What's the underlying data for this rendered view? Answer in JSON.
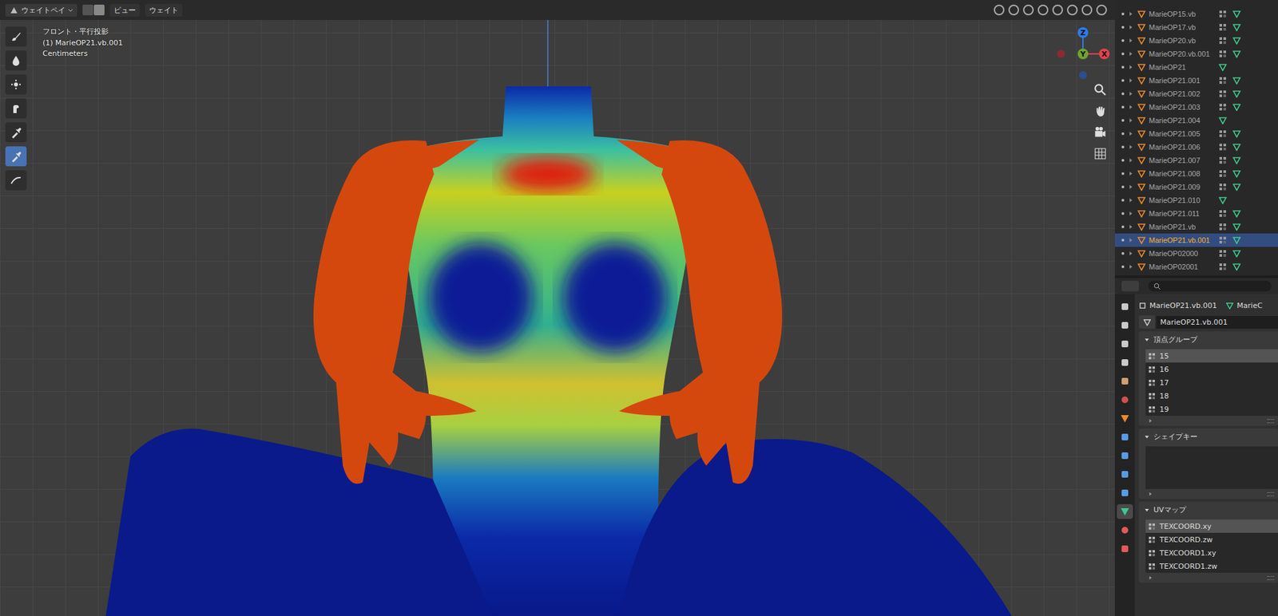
{
  "header": {
    "mode": "ウェイトペイ",
    "menus": [
      "ビュー",
      "ウェイト"
    ]
  },
  "tools": [
    {
      "kind": "brush",
      "selected": false
    },
    {
      "kind": "drop",
      "selected": false
    },
    {
      "kind": "average",
      "selected": false
    },
    {
      "kind": "smear",
      "selected": false
    },
    {
      "kind": "pipette",
      "selected": false
    },
    {
      "kind": "pipette",
      "selected": true
    },
    {
      "kind": "gradient",
      "selected": false
    }
  ],
  "viewport": {
    "overlay": [
      "フロント・平行投影",
      "(1) MarieOP21.vb.001",
      "Centimeters"
    ],
    "gizmo": [
      {
        "label": "Z",
        "color": "#2f7bea"
      },
      {
        "label": "Y",
        "color": "#6fa52a"
      },
      {
        "label": "X",
        "color": "#e3424d"
      }
    ]
  },
  "outliner": {
    "items": [
      {
        "label": "MarieOP15.vb",
        "selected": false,
        "modifiers": true
      },
      {
        "label": "MarieOP17.vb",
        "selected": false,
        "modifiers": true
      },
      {
        "label": "MarieOP20.vb",
        "selected": false,
        "modifiers": true
      },
      {
        "label": "MarieOP20.vb.001",
        "selected": false,
        "modifiers": true
      },
      {
        "label": "MarieOP21",
        "selected": false,
        "modifiers": false
      },
      {
        "label": "MarieOP21.001",
        "selected": false,
        "modifiers": true
      },
      {
        "label": "MarieOP21.002",
        "selected": false,
        "modifiers": true
      },
      {
        "label": "MarieOP21.003",
        "selected": false,
        "modifiers": true
      },
      {
        "label": "MarieOP21.004",
        "selected": false,
        "modifiers": false
      },
      {
        "label": "MarieOP21.005",
        "selected": false,
        "modifiers": true
      },
      {
        "label": "MarieOP21.006",
        "selected": false,
        "modifiers": true
      },
      {
        "label": "MarieOP21.007",
        "selected": false,
        "modifiers": true
      },
      {
        "label": "MarieOP21.008",
        "selected": false,
        "modifiers": true
      },
      {
        "label": "MarieOP21.009",
        "selected": false,
        "modifiers": true
      },
      {
        "label": "MarieOP21.010",
        "selected": false,
        "modifiers": false
      },
      {
        "label": "MarieOP21.011",
        "selected": false,
        "modifiers": true
      },
      {
        "label": "MarieOP21.vb",
        "selected": false,
        "modifiers": true
      },
      {
        "label": "MarieOP21.vb.001",
        "selected": true,
        "modifiers": true
      },
      {
        "label": "MarieOP02000",
        "selected": false,
        "modifiers": true
      },
      {
        "label": "MarieOP02001",
        "selected": false,
        "modifiers": true
      }
    ]
  },
  "properties": {
    "breadcrumb": [
      "MarieOP21.vb.001",
      "MarieC"
    ],
    "data_name": "MarieOP21.vb.001",
    "tabs": [
      {
        "kind": "tool",
        "selected": false
      },
      {
        "kind": "render",
        "selected": false
      },
      {
        "kind": "output",
        "selected": false
      },
      {
        "kind": "view",
        "selected": false
      },
      {
        "kind": "scene",
        "selected": false
      },
      {
        "kind": "world",
        "selected": false
      },
      {
        "kind": "object",
        "selected": false
      },
      {
        "kind": "modifier",
        "selected": false
      },
      {
        "kind": "particles",
        "selected": false
      },
      {
        "kind": "physics",
        "selected": false
      },
      {
        "kind": "constraints",
        "selected": false
      },
      {
        "kind": "data",
        "selected": true
      },
      {
        "kind": "material",
        "selected": false
      },
      {
        "kind": "texture",
        "selected": false
      }
    ],
    "panels": [
      {
        "title": "頂点グループ",
        "expanded": true,
        "items": [
          {
            "label": "15",
            "selected": true
          },
          {
            "label": "16",
            "selected": false
          },
          {
            "label": "17",
            "selected": false
          },
          {
            "label": "18",
            "selected": false
          },
          {
            "label": "19",
            "selected": false
          }
        ]
      },
      {
        "title": "シェイプキー",
        "expanded": true,
        "items": []
      },
      {
        "title": "UVマップ",
        "expanded": true,
        "items": [
          {
            "label": "TEXCOORD.xy",
            "selected": true
          },
          {
            "label": "TEXCOORD.zw",
            "selected": false
          },
          {
            "label": "TEXCOORD1.xy",
            "selected": false
          },
          {
            "label": "TEXCOORD1.zw",
            "selected": false
          }
        ]
      }
    ]
  }
}
